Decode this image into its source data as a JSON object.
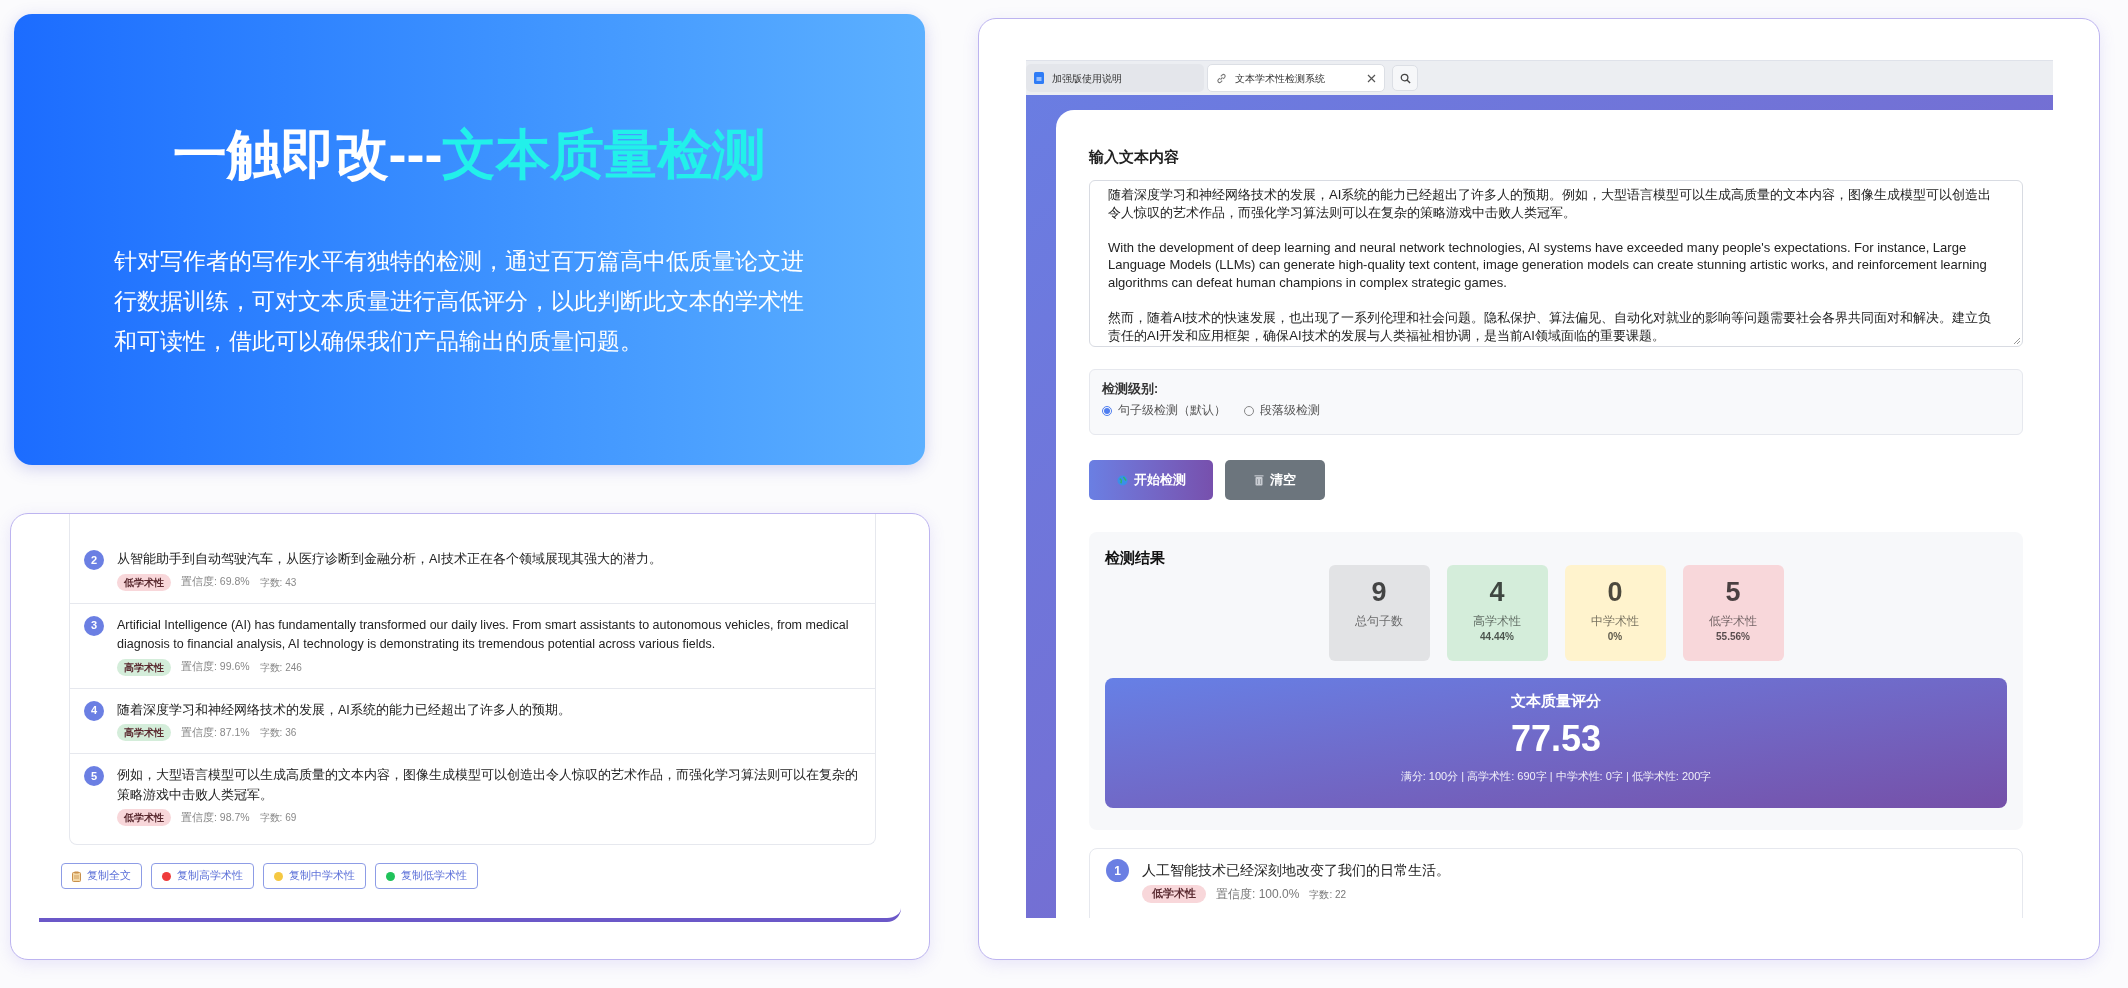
{
  "hero": {
    "title_lead": "一触即改---",
    "title_accent": "文本质量检测",
    "description": "针对写作者的写作水平有独特的检测，通过百万篇高中低质量论文进行数据训练，可对文本质量进行高低评分，以此判断此文本的学术性和可读性，借此可以确保我们产品输出的质量问题。"
  },
  "preview": {
    "sentences": [
      {
        "number": "2",
        "text": "从智能助手到自动驾驶汽车，从医疗诊断到金融分析，AI技术正在各个领域展现其强大的潜力。",
        "tag": "低学术性",
        "color": "#f8d7da",
        "confidence": "置信度: 69.8%",
        "chars": "字数: 43"
      },
      {
        "number": "3",
        "text": "Artificial Intelligence (AI) has fundamentally transformed our daily lives. From smart assistants to autonomous vehicles, from medical diagnosis to financial analysis, AI technology is demonstrating its tremendous potential across various fields.",
        "tag": "高学术性",
        "color": "#d4edda",
        "confidence": "置信度: 99.6%",
        "chars": "字数: 246"
      },
      {
        "number": "4",
        "text": "随着深度学习和神经网络技术的发展，AI系统的能力已经超出了许多人的预期。",
        "tag": "高学术性",
        "color": "#d4edda",
        "confidence": "置信度: 87.1%",
        "chars": "字数: 36"
      },
      {
        "number": "5",
        "text": "例如，大型语言模型可以生成高质量的文本内容，图像生成模型可以创造出令人惊叹的艺术作品，而强化学习算法则可以在复杂的策略游戏中击败人类冠军。",
        "tag": "低学术性",
        "color": "#f8d7da",
        "confidence": "置信度: 98.7%",
        "chars": "字数: 69"
      }
    ],
    "buttons": [
      {
        "label": "复制全文",
        "kind": "clipboard"
      },
      {
        "label": "复制高学术性",
        "kind": "dot",
        "color": "#ef3b3b"
      },
      {
        "label": "复制中学术性",
        "kind": "dot",
        "color": "#f5c842"
      },
      {
        "label": "复制低学术性",
        "kind": "dot",
        "color": "#1fc25a"
      }
    ]
  },
  "browser": {
    "tabs": [
      {
        "title": "加强版使用说明",
        "kind": "doc",
        "selected": false
      },
      {
        "title": "文本学术性检测系统",
        "kind": "link",
        "selected": true
      }
    ]
  },
  "app": {
    "input_heading": "输入文本内容",
    "input_value": "随着深度学习和神经网络技术的发展，AI系统的能力已经超出了许多人的预期。例如，大型语言模型可以生成高质量的文本内容，图像生成模型可以创造出令人惊叹的艺术作品，而强化学习算法则可以在复杂的策略游戏中击败人类冠军。\n\nWith the development of deep learning and neural network technologies, AI systems have exceeded many people's expectations. For instance, Large Language Models (LLMs) can generate high-quality text content, image generation models can create stunning artistic works, and reinforcement learning algorithms can defeat human champions in complex strategic games.\n\n然而，随着AI技术的快速发展，也出现了一系列伦理和社会问题。隐私保护、算法偏见、自动化对就业的影响等问题需要社会各界共同面对和解决。建立负责任的AI开发和应用框架，确保AI技术的发展与人类福祉相协调，是当前AI领域面临的重要课题。",
    "level_heading": "检测级别:",
    "levels": [
      {
        "label": "句子级检测（默认）",
        "selected": true
      },
      {
        "label": "段落级检测",
        "selected": false
      }
    ],
    "actions": [
      {
        "label": "开始检测",
        "kind": "primary"
      },
      {
        "label": "清空",
        "kind": "secondary"
      }
    ],
    "results": {
      "heading": "检测结果",
      "stats": [
        {
          "value": "9",
          "label": "总句子数",
          "color": "#e2e3e5"
        },
        {
          "value": "4",
          "label": "高学术性",
          "percent": "44.44%",
          "color": "#d4edda"
        },
        {
          "value": "0",
          "label": "中学术性",
          "percent": "0%",
          "color": "#fff3cd"
        },
        {
          "value": "5",
          "label": "低学术性",
          "percent": "55.56%",
          "color": "#f8d7da"
        }
      ],
      "score": {
        "title": "文本质量评分",
        "value": "77.53",
        "detail": "满分: 100分 | 高学术性: 690字 | 中学术性: 0字 | 低学术性: 200字"
      }
    },
    "sentences": [
      {
        "number": "1",
        "text": "人工智能技术已经深刻地改变了我们的日常生活。",
        "tag": "低学术性",
        "color": "#f8d7da",
        "confidence": "置信度: 100.0%",
        "chars": "字数: 22"
      }
    ]
  }
}
